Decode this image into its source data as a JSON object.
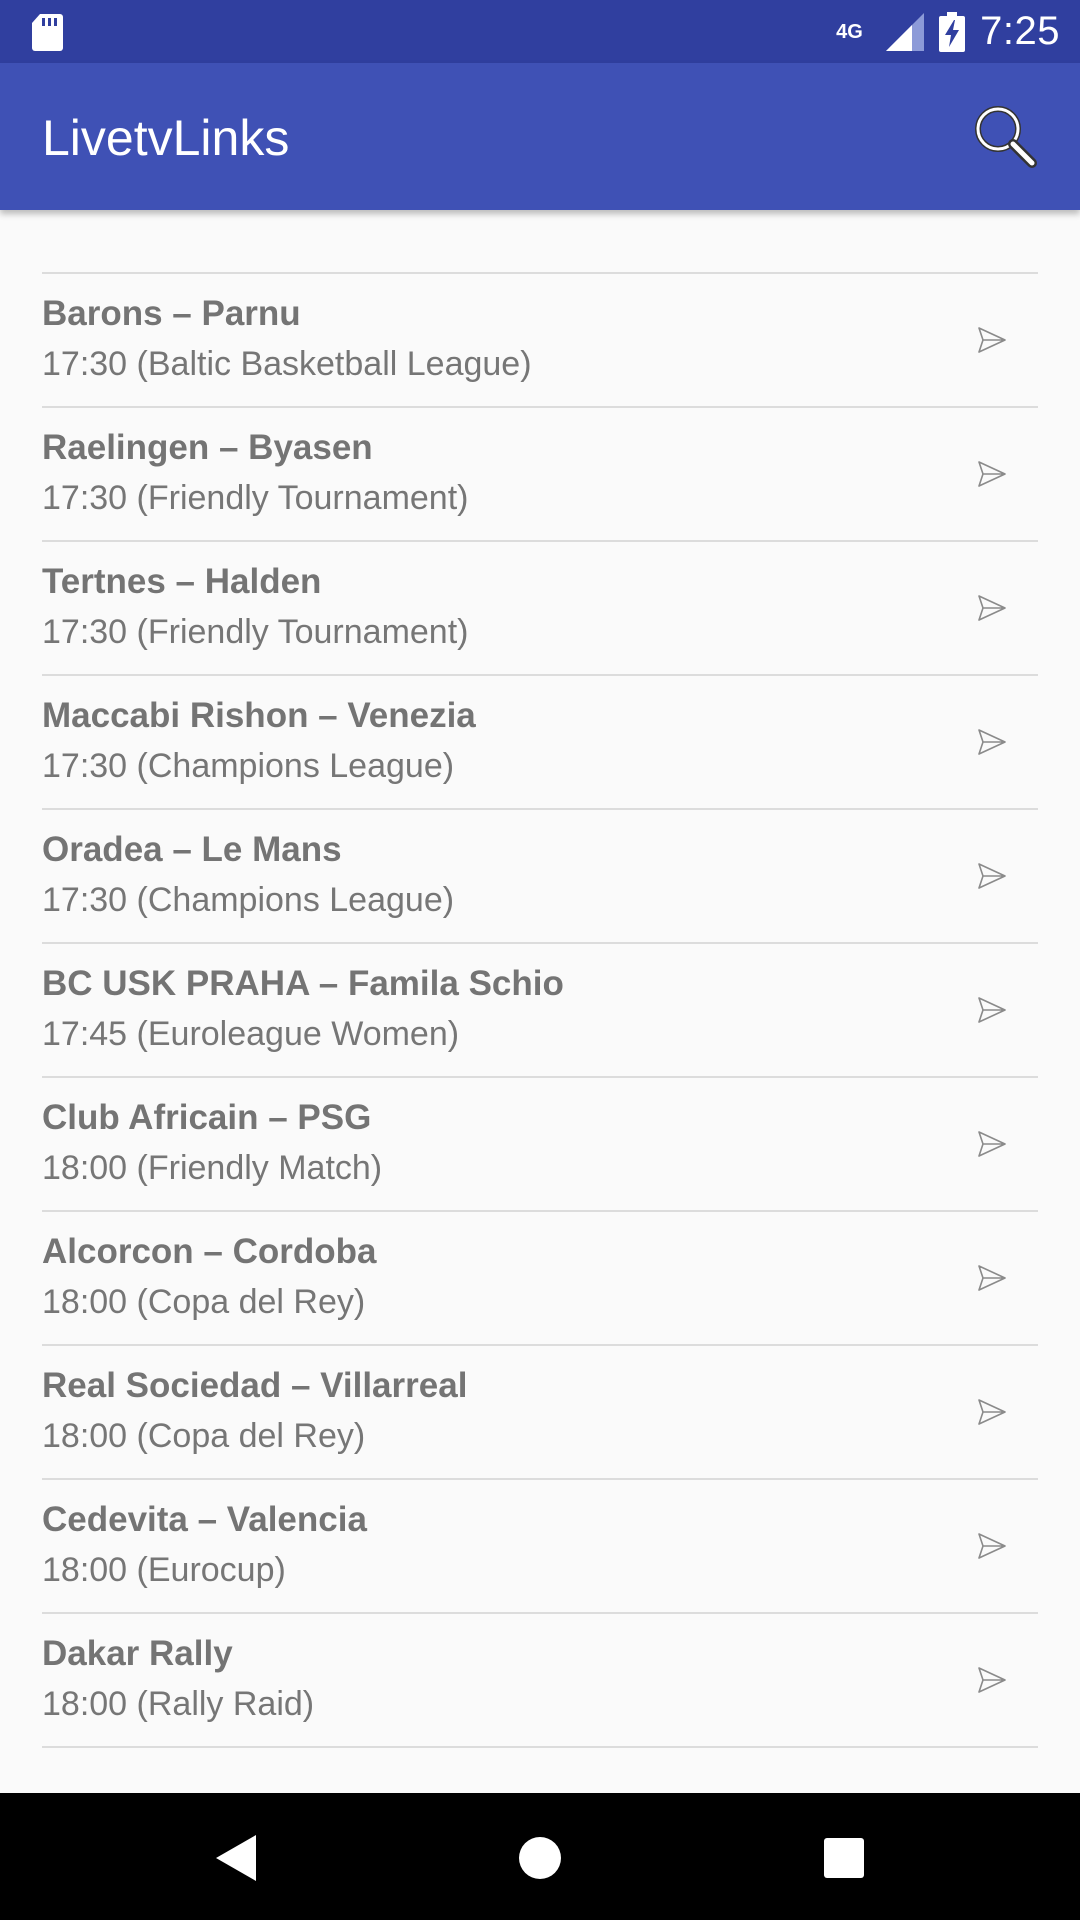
{
  "status_bar": {
    "network": "4G",
    "time": "7:25",
    "icons": [
      "sd-card-icon",
      "signal-icon",
      "battery-charging-icon"
    ]
  },
  "app_bar": {
    "title": "LivetvLinks",
    "search_icon": "search-icon"
  },
  "list": {
    "items": [
      {
        "title": "Barons – Parnu",
        "subtitle": "17:30 (Baltic Basketball League)"
      },
      {
        "title": "Raelingen – Byasen",
        "subtitle": "17:30 (Friendly Tournament)"
      },
      {
        "title": "Tertnes – Halden",
        "subtitle": "17:30 (Friendly Tournament)"
      },
      {
        "title": "Maccabi Rishon – Venezia",
        "subtitle": "17:30 (Champions League)"
      },
      {
        "title": "Oradea – Le Mans",
        "subtitle": "17:30 (Champions League)"
      },
      {
        "title": "BC USK PRAHA – Famila Schio",
        "subtitle": "17:45 (Euroleague Women)"
      },
      {
        "title": "Club Africain – PSG",
        "subtitle": "18:00 (Friendly Match)"
      },
      {
        "title": "Alcorcon – Cordoba",
        "subtitle": "18:00 (Copa del Rey)"
      },
      {
        "title": "Real Sociedad – Villarreal",
        "subtitle": "18:00 (Copa del Rey)"
      },
      {
        "title": "Cedevita – Valencia",
        "subtitle": "18:00 (Eurocup)"
      },
      {
        "title": "Dakar Rally",
        "subtitle": "18:00 (Rally Raid)"
      }
    ]
  },
  "nav_bar": {
    "buttons": [
      "back-icon",
      "home-icon",
      "recents-icon"
    ]
  },
  "colors": {
    "status_bar": "#303f9f",
    "app_bar": "#3f51b5",
    "background": "#fafafa",
    "text": "#747474"
  }
}
